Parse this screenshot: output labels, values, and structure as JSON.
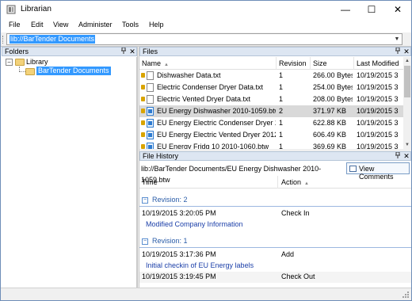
{
  "window": {
    "title": "Librarian",
    "minimize_glyph": "—",
    "maximize_glyph": "☐",
    "close_glyph": "✕"
  },
  "menu": {
    "items": [
      "File",
      "Edit",
      "View",
      "Administer",
      "Tools",
      "Help"
    ]
  },
  "address": {
    "value": "lib://BarTender Documents"
  },
  "folders": {
    "title": "Folders",
    "tree": {
      "root": "Library",
      "child": "BarTender Documents"
    }
  },
  "files": {
    "title": "Files",
    "columns": [
      "Name",
      "Revision",
      "Size",
      "Last Modified"
    ],
    "rows": [
      {
        "name": "Dishwasher Data.txt",
        "revision": "1",
        "size": "266.00 Bytes",
        "modified": "10/19/2015 3",
        "type": "txt"
      },
      {
        "name": "Electric Condenser Dryer Data.txt",
        "revision": "1",
        "size": "254.00 Bytes",
        "modified": "10/19/2015 3",
        "type": "txt"
      },
      {
        "name": "Electric Vented Dryer Data.txt",
        "revision": "1",
        "size": "208.00 Bytes",
        "modified": "10/19/2015 3",
        "type": "txt"
      },
      {
        "name": "EU Energy Dishwasher 2010-1059.btw",
        "revision": "2",
        "size": "371.97 KB",
        "modified": "10/19/2015 3",
        "type": "btw",
        "selected": true
      },
      {
        "name": "EU Energy Electric Condenser Dryer 20...",
        "revision": "1",
        "size": "622.88 KB",
        "modified": "10/19/2015 3",
        "type": "btw"
      },
      {
        "name": "EU Energy Electric Vented Dryer 2012-0...",
        "revision": "1",
        "size": "606.49 KB",
        "modified": "10/19/2015 3",
        "type": "btw"
      },
      {
        "name": "EU Energy Fridg 10 2010-1060.btw",
        "revision": "1",
        "size": "369.69 KB",
        "modified": "10/19/2015 3",
        "type": "btw"
      }
    ]
  },
  "history": {
    "title": "File History",
    "path": "lib://BarTender Documents/EU Energy Dishwasher 2010-1059.btw",
    "view_comments_label": "View Comments",
    "columns": [
      "Time",
      "Action"
    ],
    "groups": [
      {
        "label": "Revision: 2",
        "entries": [
          {
            "time": "10/19/2015 3:20:05 PM",
            "action": "Check In",
            "note": "Modified Company Information"
          }
        ]
      },
      {
        "label": "Revision: 1",
        "entries": [
          {
            "time": "10/19/2015 3:17:36 PM",
            "action": "Add",
            "note": "Initial checkin of EU Energy labels"
          },
          {
            "time": "10/19/2015 3:19:45 PM",
            "action": "Check Out",
            "note": ""
          }
        ]
      }
    ]
  },
  "glyphs": {
    "pin": "📌",
    "close_small": "✕",
    "sort_up": "▲",
    "dropdown": "▼",
    "scroll_up": "▲",
    "scroll_down": "▼",
    "minus": "−"
  },
  "colors": {
    "selection": "#3399ff",
    "header_bg": "#dde6f2",
    "revision_text": "#2a5ca8",
    "note_text": "#1a3ea8"
  }
}
